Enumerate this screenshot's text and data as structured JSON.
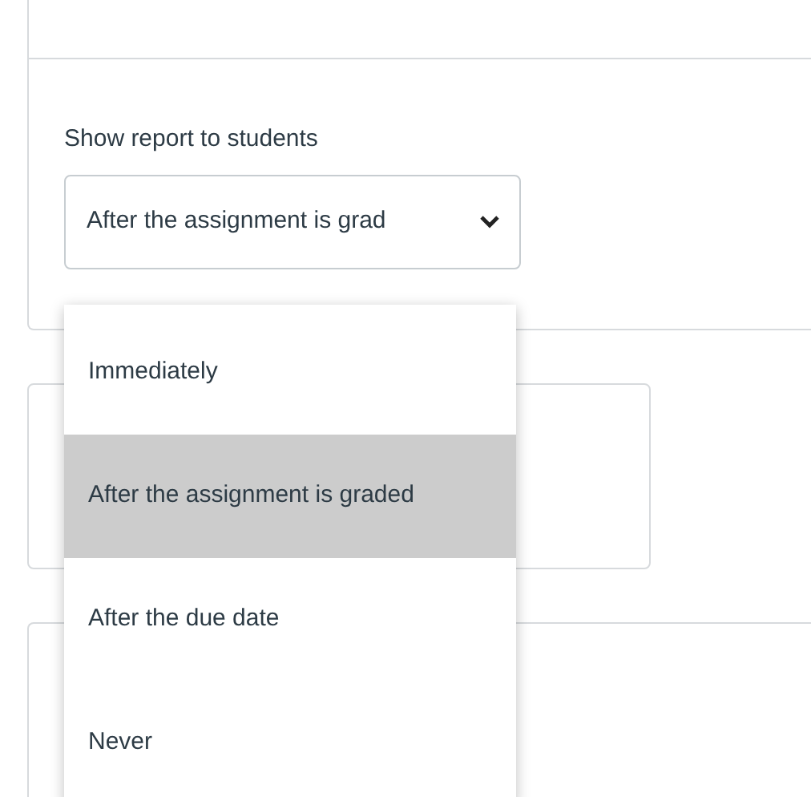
{
  "report_setting": {
    "label": "Show report to students",
    "value": "After the assignment is grad",
    "expanded": true
  },
  "options": [
    {
      "label": "Immediately",
      "selected": false
    },
    {
      "label": "After the assignment is graded",
      "selected": true
    },
    {
      "label": "After the due date",
      "selected": false
    },
    {
      "label": "Never",
      "selected": false
    }
  ]
}
